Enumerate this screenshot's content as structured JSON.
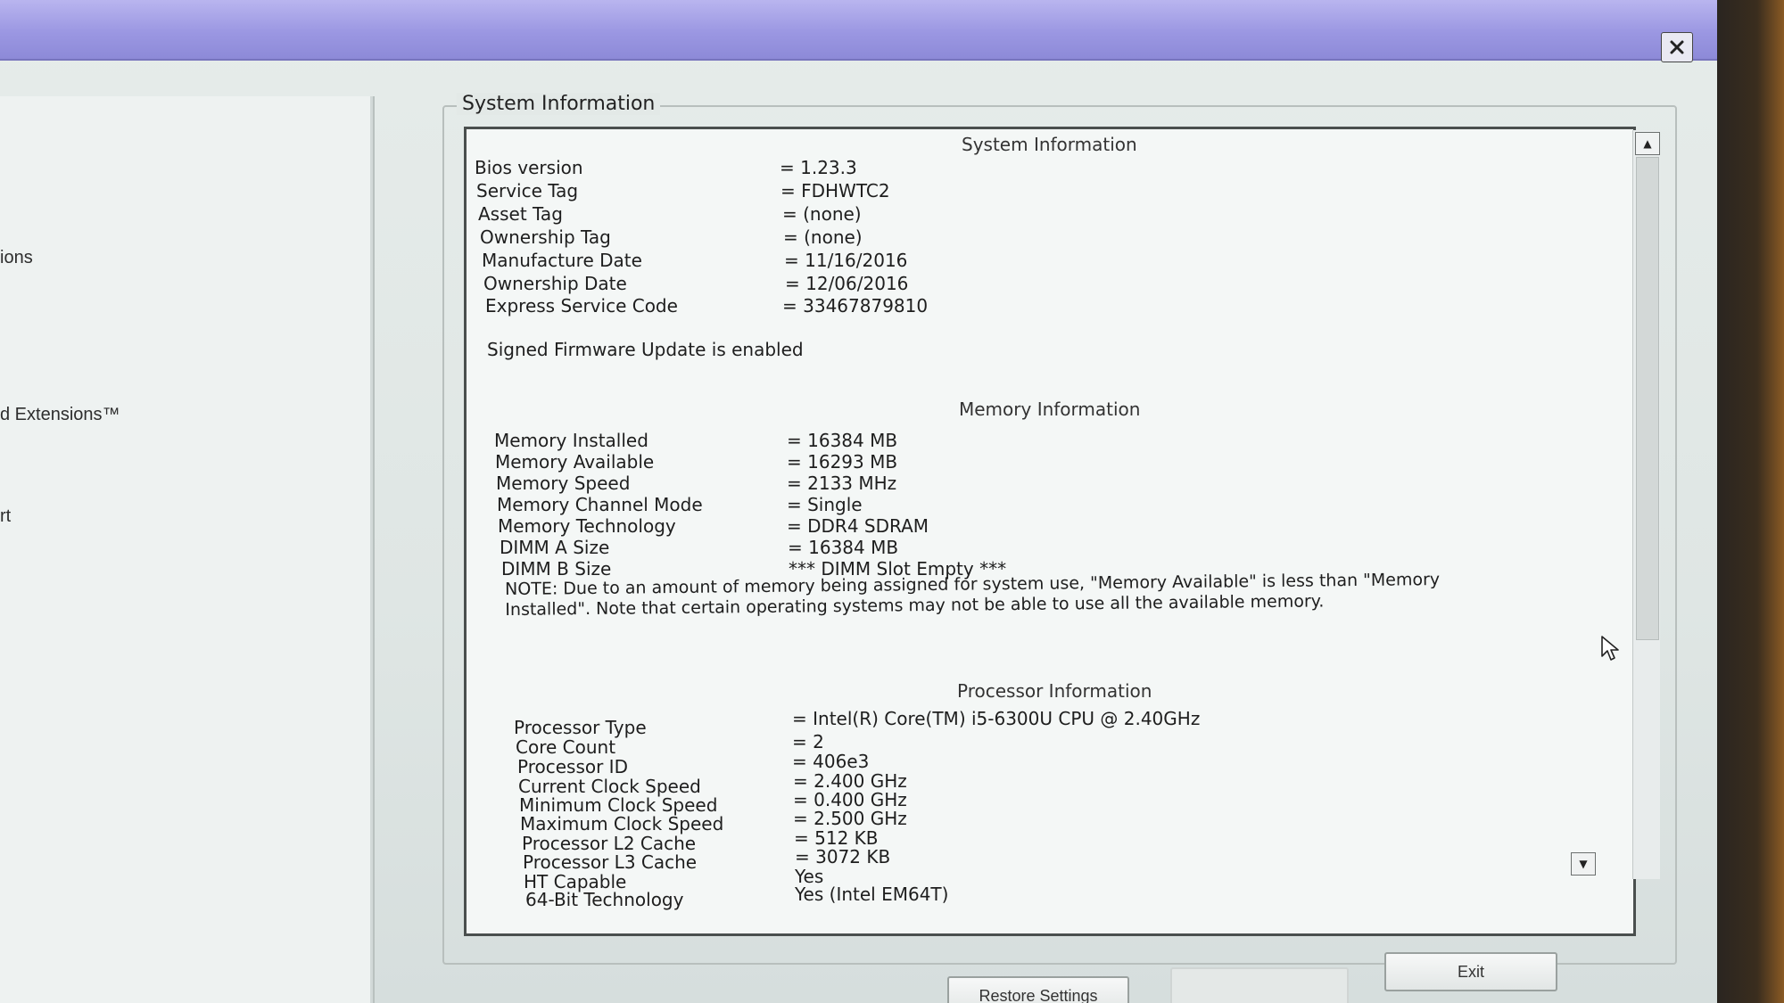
{
  "window": {
    "close_icon": "close-icon"
  },
  "left_nav": {
    "items": [
      {
        "label": "ions"
      },
      {
        "label": "d Extensions™"
      },
      {
        "label": "rt"
      }
    ]
  },
  "group_title": "System Information",
  "system_info": {
    "heading": "System Information",
    "rows": [
      {
        "label": "Bios version",
        "value": "= 1.23.3"
      },
      {
        "label": "Service Tag",
        "value": "= FDHWTC2"
      },
      {
        "label": "Asset Tag",
        "value": "= (none)"
      },
      {
        "label": "Ownership Tag",
        "value": "= (none)"
      },
      {
        "label": "Manufacture Date",
        "value": "= 11/16/2016"
      },
      {
        "label": "Ownership Date",
        "value": "= 12/06/2016"
      },
      {
        "label": "Express Service Code",
        "value": "= 33467879810"
      }
    ],
    "firmware_note": "Signed Firmware Update is enabled"
  },
  "memory_info": {
    "heading": "Memory Information",
    "rows": [
      {
        "label": "Memory Installed",
        "value": "= 16384 MB"
      },
      {
        "label": "Memory Available",
        "value": "= 16293 MB"
      },
      {
        "label": "Memory Speed",
        "value": "= 2133 MHz"
      },
      {
        "label": "Memory Channel Mode",
        "value": "= Single"
      },
      {
        "label": "Memory Technology",
        "value": "= DDR4 SDRAM"
      },
      {
        "label": "DIMM A Size",
        "value": "= 16384 MB"
      },
      {
        "label": "DIMM B Size",
        "value": "*** DIMM Slot Empty ***"
      }
    ],
    "note": "NOTE: Due to an amount of memory being assigned for system use, \"Memory Available\" is less than \"Memory Installed\". Note that certain operating systems may not be able to use all the available memory."
  },
  "processor_info": {
    "heading": "Processor Information",
    "rows": [
      {
        "label": "Processor Type",
        "value": "= Intel(R) Core(TM) i5-6300U CPU @ 2.40GHz"
      },
      {
        "label": "Core Count",
        "value": "= 2"
      },
      {
        "label": "Processor ID",
        "value": "= 406e3"
      },
      {
        "label": "Current Clock Speed",
        "value": "= 2.400 GHz"
      },
      {
        "label": "Minimum Clock Speed",
        "value": "= 0.400 GHz"
      },
      {
        "label": "Maximum Clock Speed",
        "value": "= 2.500 GHz"
      },
      {
        "label": "Processor L2 Cache",
        "value": "= 512 KB"
      },
      {
        "label": "Processor L3 Cache",
        "value": "= 3072 KB"
      },
      {
        "label": "HT Capable",
        "value": "Yes"
      },
      {
        "label": "64-Bit Technology",
        "value": "Yes (Intel EM64T)"
      }
    ]
  },
  "buttons": {
    "restore_settings": "Restore Settings",
    "apply": "",
    "exit": "Exit"
  }
}
